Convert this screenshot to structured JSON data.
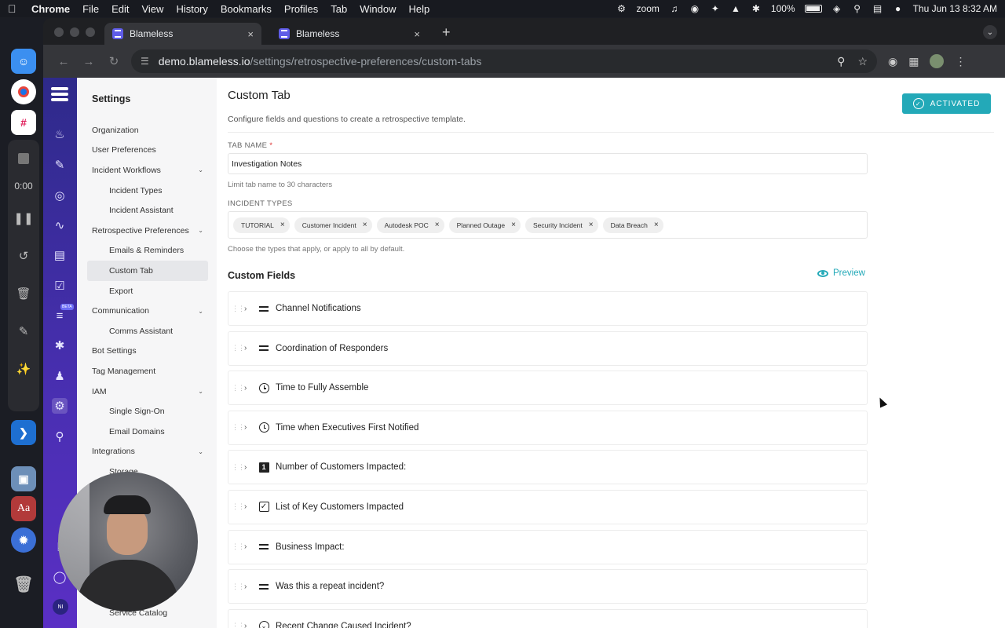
{
  "menubar": {
    "apple_icon": "apple-icon",
    "items": [
      "Chrome",
      "File",
      "Edit",
      "View",
      "History",
      "Bookmarks",
      "Profiles",
      "Tab",
      "Window",
      "Help"
    ],
    "zoom_label": "zoom",
    "battery": "100%",
    "datetime": "Thu Jun 13  8:32 AM"
  },
  "browser": {
    "tabs": [
      {
        "title": "Blameless",
        "close": "×"
      },
      {
        "title": "Blameless",
        "close": "×"
      }
    ],
    "new_tab": "+",
    "url_host": "demo.blameless.io",
    "url_path": "/settings/retrospective-preferences/custom-tabs"
  },
  "sidebar": {
    "title": "Settings",
    "items": [
      {
        "label": "Organization",
        "level": 0
      },
      {
        "label": "User Preferences",
        "level": 0
      },
      {
        "label": "Incident Workflows",
        "level": 0,
        "expandable": true
      },
      {
        "label": "Incident Types",
        "level": 1
      },
      {
        "label": "Incident Assistant",
        "level": 1
      },
      {
        "label": "Retrospective Preferences",
        "level": 0,
        "expandable": true
      },
      {
        "label": "Emails & Reminders",
        "level": 1
      },
      {
        "label": "Custom Tab",
        "level": 1,
        "active": true
      },
      {
        "label": "Export",
        "level": 1
      },
      {
        "label": "Communication",
        "level": 0,
        "expandable": true
      },
      {
        "label": "Comms Assistant",
        "level": 1
      },
      {
        "label": "Bot Settings",
        "level": 0
      },
      {
        "label": "Tag Management",
        "level": 0
      },
      {
        "label": "IAM",
        "level": 0,
        "expandable": true
      },
      {
        "label": "Single Sign-On",
        "level": 1
      },
      {
        "label": "Email Domains",
        "level": 1
      },
      {
        "label": "Integrations",
        "level": 0,
        "expandable": true
      },
      {
        "label": "Storage",
        "level": 1
      }
    ],
    "bottom_item": "Service Catalog"
  },
  "rail": {
    "beta_label": "BETA",
    "user_initials": "NI"
  },
  "main": {
    "title": "Custom Tab",
    "description": "Configure fields and questions to create a retrospective template.",
    "status_button": "ACTIVATED",
    "tab_name_label": "TAB NAME",
    "required_mark": "*",
    "tab_name_value": "Investigation Notes",
    "tab_name_hint": "Limit tab name to 30 characters",
    "incident_types_label": "INCIDENT TYPES",
    "incident_types": [
      "TUTORIAL",
      "Customer Incident",
      "Autodesk POC",
      "Planned Outage",
      "Security Incident",
      "Data Breach"
    ],
    "chip_remove": "×",
    "incident_types_hint": "Choose the types that apply, or apply to all by default.",
    "custom_fields_title": "Custom Fields",
    "preview_label": "Preview",
    "fields": [
      {
        "label": "Channel Notifications",
        "icon": "text-field-icon"
      },
      {
        "label": "Coordination of Responders",
        "icon": "text-field-icon"
      },
      {
        "label": "Time to Fully Assemble",
        "icon": "clock-icon"
      },
      {
        "label": "Time when Executives First Notified",
        "icon": "clock-icon"
      },
      {
        "label": "Number of Customers Impacted:",
        "icon": "number-icon"
      },
      {
        "label": "List of Key Customers Impacted",
        "icon": "checkbox-icon"
      },
      {
        "label": "Business Impact:",
        "icon": "text-field-icon"
      },
      {
        "label": "Was this a repeat incident?",
        "icon": "text-field-icon"
      },
      {
        "label": "Recent Change Caused Incident?",
        "icon": "radio-icon"
      }
    ]
  },
  "recording": {
    "timer": "0:00"
  },
  "colors": {
    "accent": "#23a9b8",
    "rail": "#4a2fb3"
  }
}
